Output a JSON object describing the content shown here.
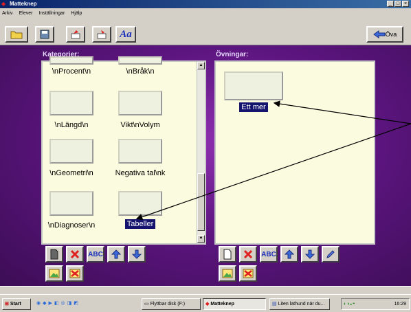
{
  "window": {
    "title": "Matteknep"
  },
  "menu": [
    "Arkiv",
    "Elever",
    "Inställningar",
    "Hjälp"
  ],
  "toolbar": {
    "font_label": "Aa",
    "back_label": "Öva"
  },
  "categories": {
    "heading": "Kategorier:",
    "items": [
      {
        "label": "\\nProcent\\n"
      },
      {
        "label": "\\nBråk\\n"
      },
      {
        "label": "\\nLängd\\n"
      },
      {
        "label": "Vikt\\nVolym"
      },
      {
        "label": "\\nGeometri\\n"
      },
      {
        "label": "Negativa tal\\nk"
      },
      {
        "label": "\\nDiagnoser\\n"
      },
      {
        "label": "Tabeller",
        "selected": true
      }
    ],
    "text_button": "ABC"
  },
  "exercises": {
    "heading": "Övningar:",
    "items": [
      {
        "label": "Ett mer",
        "selected": true
      }
    ],
    "text_button": "ABC"
  },
  "taskbar": {
    "start": "Start",
    "items": [
      "Flyttbar disk (F:)",
      "Matteknep",
      "Liten lathund när du..."
    ],
    "clock": "16:29"
  },
  "colors": {
    "selection": "#14146e",
    "panel": "#fbfbdf",
    "background": "#5d1580",
    "delete": "#e02020",
    "arrows": "#3c6ad8"
  }
}
